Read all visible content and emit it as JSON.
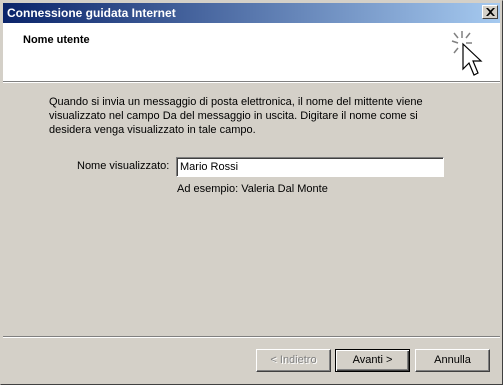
{
  "window": {
    "title": "Connessione guidata Internet",
    "close_icon": "close-icon"
  },
  "header": {
    "title": "Nome utente",
    "icon": "wizard-cursor-icon"
  },
  "body": {
    "description": "Quando si invia un messaggio di posta elettronica, il nome del mittente viene visualizzato nel campo Da del messaggio in uscita. Digitare il nome come si desidera venga visualizzato in tale campo.",
    "field_label": "Nome visualizzato:",
    "field_value": "Mario Rossi",
    "example": "Ad esempio: Valeria Dal Monte"
  },
  "buttons": {
    "back": "< Indietro",
    "next": "Avanti >",
    "cancel": "Annulla"
  },
  "colors": {
    "titlebar_start": "#0a246a",
    "titlebar_end": "#a6caf0",
    "face": "#d4d0c8"
  }
}
